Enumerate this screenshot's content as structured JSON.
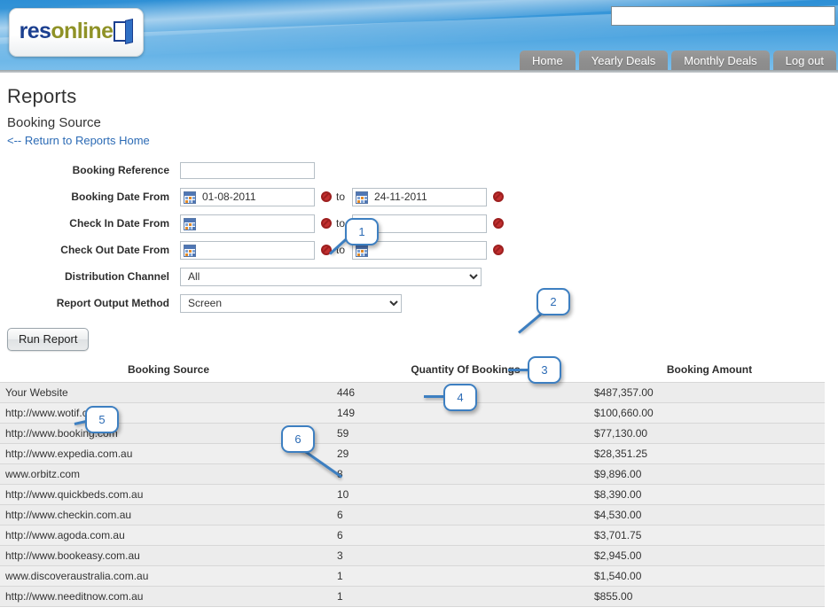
{
  "header": {
    "logo": {
      "part1": "res",
      "part2": "online",
      "icon": "door-icon"
    },
    "search": {
      "value": "",
      "placeholder": ""
    },
    "nav": [
      {
        "label": "Home",
        "name": "nav-home"
      },
      {
        "label": "Yearly Deals",
        "name": "nav-yearly-deals"
      },
      {
        "label": "Monthly Deals",
        "name": "nav-monthly-deals"
      },
      {
        "label": "Log out",
        "name": "nav-log-out"
      }
    ]
  },
  "page": {
    "title": "Reports",
    "subtitle": "Booking Source",
    "return_link": "<-- Return to Reports Home"
  },
  "form": {
    "booking_reference": {
      "label": "Booking Reference",
      "value": ""
    },
    "booking_date": {
      "label": "Booking Date From",
      "from": "01-08-2011",
      "to_label": "to",
      "to": "24-11-2011"
    },
    "check_in_date": {
      "label": "Check In Date From",
      "from": "",
      "to_label": "to",
      "to": ""
    },
    "check_out_date": {
      "label": "Check Out Date From",
      "from": "",
      "to_label": "to",
      "to": ""
    },
    "distribution_channel": {
      "label": "Distribution Channel",
      "selected": "All",
      "options": [
        "All"
      ]
    },
    "report_output_method": {
      "label": "Report Output Method",
      "selected": "Screen",
      "options": [
        "Screen"
      ]
    },
    "run_button": "Run Report"
  },
  "table": {
    "columns": [
      "Booking Source",
      "Quantity Of Bookings",
      "Booking Amount"
    ],
    "rows": [
      {
        "source": "Your Website",
        "quantity": "446",
        "amount": "$487,357.00"
      },
      {
        "source": "http://www.wotif.com",
        "quantity": "149",
        "amount": "$100,660.00"
      },
      {
        "source": "http://www.booking.com",
        "quantity": "59",
        "amount": "$77,130.00"
      },
      {
        "source": "http://www.expedia.com.au",
        "quantity": "29",
        "amount": "$28,351.25"
      },
      {
        "source": "www.orbitz.com",
        "quantity": "8",
        "amount": "$9,896.00"
      },
      {
        "source": "http://www.quickbeds.com.au",
        "quantity": "10",
        "amount": "$8,390.00"
      },
      {
        "source": "http://www.checkin.com.au",
        "quantity": "6",
        "amount": "$4,530.00"
      },
      {
        "source": "http://www.agoda.com.au",
        "quantity": "6",
        "amount": "$3,701.75"
      },
      {
        "source": "http://www.bookeasy.com.au",
        "quantity": "3",
        "amount": "$2,945.00"
      },
      {
        "source": "www.discoveraustralia.com.au",
        "quantity": "1",
        "amount": "$1,540.00"
      },
      {
        "source": "http://www.needitnow.com.au",
        "quantity": "1",
        "amount": "$855.00"
      }
    ]
  },
  "callouts": [
    {
      "number": "1"
    },
    {
      "number": "2"
    },
    {
      "number": "3"
    },
    {
      "number": "4"
    },
    {
      "number": "5"
    },
    {
      "number": "6"
    }
  ],
  "colors": {
    "banner_blue": "#3f9cdc",
    "link_blue": "#2c6bb5",
    "callout_blue": "#3d7fc1",
    "logo_dark_blue": "#1b3f8f",
    "logo_olive": "#8f9227",
    "clear_red": "#c23030",
    "row_gray": "#ececec"
  }
}
